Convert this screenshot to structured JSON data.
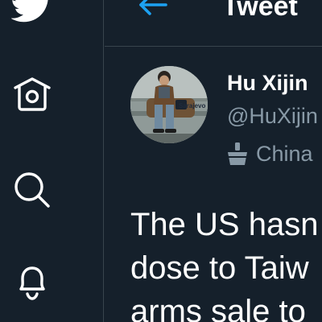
{
  "nav": {
    "items": [
      {
        "icon": "twitter-bird-icon"
      },
      {
        "icon": "home-icon"
      },
      {
        "icon": "search-icon"
      },
      {
        "icon": "bell-icon"
      }
    ]
  },
  "header": {
    "title": "Tweet",
    "back_icon": "arrow-left-icon"
  },
  "author": {
    "display_name": "Hu Xijin",
    "handle": "@HuXijin",
    "affiliation_icon": "state-affiliated-icon",
    "affiliation": "China",
    "avatar_caption": "Sarajevo"
  },
  "tweet": {
    "lines": [
      "The US hasn",
      "dose to Taiw",
      "arms sale to"
    ]
  },
  "colors": {
    "background": "#15202b",
    "border": "#38444d",
    "accent": "#1da1f2",
    "secondary_text": "#8899a6",
    "primary_text": "#ffffff"
  }
}
